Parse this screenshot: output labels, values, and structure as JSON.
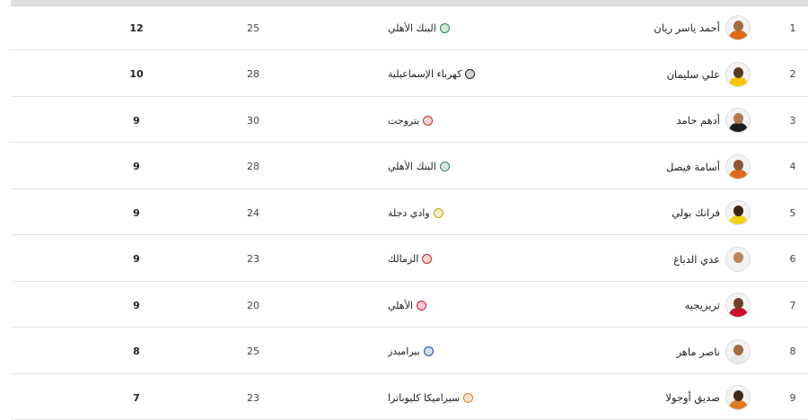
{
  "rows": [
    {
      "rank": "1",
      "player": "أحمد ياسر ريان",
      "team": "البنك الأهلي",
      "matches": "25",
      "goals": "12",
      "avatar_skin": "#a56a45",
      "avatar_shirt": "#e06b1f",
      "logo_color": "#2e8b57"
    },
    {
      "rank": "2",
      "player": "علي سليمان",
      "team": "كهرباء الإسماعيلية",
      "matches": "28",
      "goals": "10",
      "avatar_skin": "#5a3a22",
      "avatar_shirt": "#f4c400",
      "logo_color": "#222222"
    },
    {
      "rank": "3",
      "player": "أدهم حامد",
      "team": "بتروجت",
      "matches": "30",
      "goals": "9",
      "avatar_skin": "#b07a55",
      "avatar_shirt": "#1c1c1c",
      "logo_color": "#d42a2a"
    },
    {
      "rank": "4",
      "player": "أسامة فيصل",
      "team": "البنك الأهلي",
      "matches": "28",
      "goals": "9",
      "avatar_skin": "#8a5836",
      "avatar_shirt": "#e06b1f",
      "logo_color": "#2e8b57"
    },
    {
      "rank": "5",
      "player": "فرانك بولي",
      "team": "وادي دجلة",
      "matches": "24",
      "goals": "9",
      "avatar_skin": "#3d2517",
      "avatar_shirt": "#f2d21b",
      "logo_color": "#c9a500"
    },
    {
      "rank": "6",
      "player": "عدي الدباغ",
      "team": "الزمالك",
      "matches": "23",
      "goals": "9",
      "avatar_skin": "#b98260",
      "avatar_shirt": "#f1f1f1",
      "logo_color": "#c62828"
    },
    {
      "rank": "7",
      "player": "تريزيجيه",
      "team": "الأهلي",
      "matches": "20",
      "goals": "9",
      "avatar_skin": "#6b4128",
      "avatar_shirt": "#c8102e",
      "logo_color": "#c8102e"
    },
    {
      "rank": "8",
      "player": "ناصر ماهر",
      "team": "بيراميدز",
      "matches": "25",
      "goals": "8",
      "avatar_skin": "#a06c48",
      "avatar_shirt": "#eaeaea",
      "logo_color": "#1b4f9c"
    },
    {
      "rank": "9",
      "player": "صديق أوجولا",
      "team": "سيراميكا كليوباترا",
      "matches": "23",
      "goals": "7",
      "avatar_skin": "#3e2618",
      "avatar_shirt": "#e07a1f",
      "logo_color": "#e07a1f"
    }
  ]
}
